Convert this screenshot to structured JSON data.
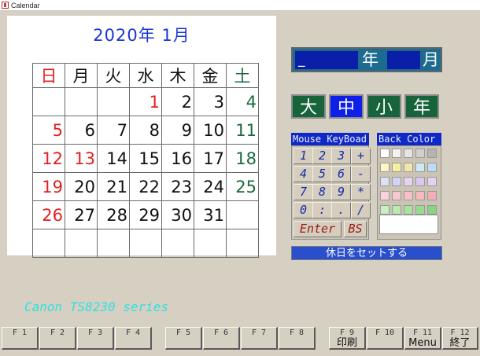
{
  "window": {
    "title": "Calendar"
  },
  "calendar": {
    "title": "2020年 1月",
    "weekdays": [
      "日",
      "月",
      "火",
      "水",
      "木",
      "金",
      "土"
    ],
    "weeks": [
      [
        "",
        "",
        "",
        "1",
        "2",
        "3",
        "4"
      ],
      [
        "5",
        "6",
        "7",
        "8",
        "9",
        "10",
        "11"
      ],
      [
        "12",
        "13",
        "14",
        "15",
        "16",
        "17",
        "18"
      ],
      [
        "19",
        "20",
        "21",
        "22",
        "23",
        "24",
        "25"
      ],
      [
        "26",
        "27",
        "28",
        "29",
        "30",
        "31",
        ""
      ],
      [
        "",
        "",
        "",
        "",
        "",
        "",
        ""
      ]
    ],
    "colors": {
      "sunday": "#e32020",
      "holiday": "#e32020",
      "saturday": "#1a6a3c",
      "title": "#1a35d4"
    }
  },
  "year_month_input": {
    "year_value": "_",
    "year_label": "年",
    "month_value": "",
    "month_label": "月"
  },
  "size_buttons": [
    {
      "label": "大",
      "active": false
    },
    {
      "label": "中",
      "active": true
    },
    {
      "label": "小",
      "active": false
    },
    {
      "label": "年",
      "active": false
    }
  ],
  "keypad": {
    "title": "Mouse KeyBoad",
    "rows": [
      [
        "1",
        "2",
        "3",
        "+"
      ],
      [
        "4",
        "5",
        "6",
        "-"
      ],
      [
        "7",
        "8",
        "9",
        "*"
      ],
      [
        "0",
        ":",
        ".",
        "/"
      ]
    ],
    "enter_label": "Enter",
    "bs_label": "BS"
  },
  "back_color": {
    "title": "Back Color",
    "swatches": [
      [
        "#ffffff",
        "#f2f2f2",
        "#e4e4e4",
        "#d0d0d0",
        "#b4b4b4"
      ],
      [
        "#fdf6c4",
        "#f5f0a0",
        "#f0e8a8",
        "#cfe8f6",
        "#bedaf6"
      ],
      [
        "#dce0f8",
        "#cfd4f4",
        "#e6d4ee",
        "#d9c8ee",
        "#e4d2f2"
      ],
      [
        "#fbd2dc",
        "#f8c8d0",
        "#f6c2c8",
        "#f8b8c0",
        "#f4aeb8"
      ],
      [
        "#c8f0c0",
        "#b8eab0",
        "#a8e4a0",
        "#98dc90",
        "#88d480"
      ]
    ],
    "selected": "#ffffff"
  },
  "holiday_button": {
    "label": "休日をセットする"
  },
  "printer": {
    "name": "Canon TS8230 series"
  },
  "function_keys": [
    {
      "key": "F 1",
      "label": ""
    },
    {
      "key": "F 2",
      "label": ""
    },
    {
      "key": "F 3",
      "label": ""
    },
    {
      "key": "F 4",
      "label": ""
    },
    {
      "key": "F 5",
      "label": ""
    },
    {
      "key": "F 6",
      "label": ""
    },
    {
      "key": "F 7",
      "label": ""
    },
    {
      "key": "F 8",
      "label": ""
    },
    {
      "key": "F 9",
      "label": "印刷"
    },
    {
      "key": "F 10",
      "label": ""
    },
    {
      "key": "F 11",
      "label": "Menu"
    },
    {
      "key": "F 12",
      "label": "終了"
    }
  ]
}
